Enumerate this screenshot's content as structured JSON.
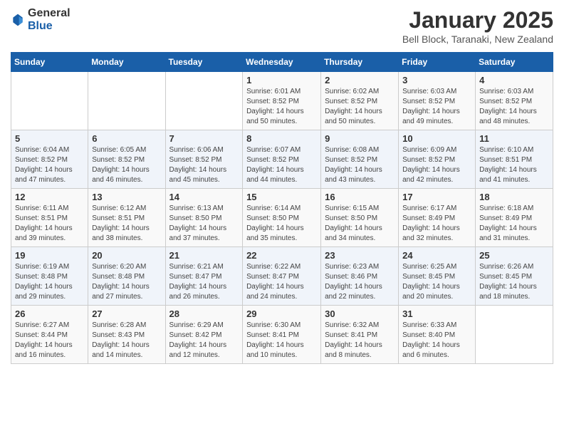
{
  "header": {
    "logo_general": "General",
    "logo_blue": "Blue",
    "month_title": "January 2025",
    "location": "Bell Block, Taranaki, New Zealand"
  },
  "days": [
    "Sunday",
    "Monday",
    "Tuesday",
    "Wednesday",
    "Thursday",
    "Friday",
    "Saturday"
  ],
  "weeks": [
    [
      {
        "date": "",
        "info": ""
      },
      {
        "date": "",
        "info": ""
      },
      {
        "date": "",
        "info": ""
      },
      {
        "date": "1",
        "info": "Sunrise: 6:01 AM\nSunset: 8:52 PM\nDaylight: 14 hours\nand 50 minutes."
      },
      {
        "date": "2",
        "info": "Sunrise: 6:02 AM\nSunset: 8:52 PM\nDaylight: 14 hours\nand 50 minutes."
      },
      {
        "date": "3",
        "info": "Sunrise: 6:03 AM\nSunset: 8:52 PM\nDaylight: 14 hours\nand 49 minutes."
      },
      {
        "date": "4",
        "info": "Sunrise: 6:03 AM\nSunset: 8:52 PM\nDaylight: 14 hours\nand 48 minutes."
      }
    ],
    [
      {
        "date": "5",
        "info": "Sunrise: 6:04 AM\nSunset: 8:52 PM\nDaylight: 14 hours\nand 47 minutes."
      },
      {
        "date": "6",
        "info": "Sunrise: 6:05 AM\nSunset: 8:52 PM\nDaylight: 14 hours\nand 46 minutes."
      },
      {
        "date": "7",
        "info": "Sunrise: 6:06 AM\nSunset: 8:52 PM\nDaylight: 14 hours\nand 45 minutes."
      },
      {
        "date": "8",
        "info": "Sunrise: 6:07 AM\nSunset: 8:52 PM\nDaylight: 14 hours\nand 44 minutes."
      },
      {
        "date": "9",
        "info": "Sunrise: 6:08 AM\nSunset: 8:52 PM\nDaylight: 14 hours\nand 43 minutes."
      },
      {
        "date": "10",
        "info": "Sunrise: 6:09 AM\nSunset: 8:52 PM\nDaylight: 14 hours\nand 42 minutes."
      },
      {
        "date": "11",
        "info": "Sunrise: 6:10 AM\nSunset: 8:51 PM\nDaylight: 14 hours\nand 41 minutes."
      }
    ],
    [
      {
        "date": "12",
        "info": "Sunrise: 6:11 AM\nSunset: 8:51 PM\nDaylight: 14 hours\nand 39 minutes."
      },
      {
        "date": "13",
        "info": "Sunrise: 6:12 AM\nSunset: 8:51 PM\nDaylight: 14 hours\nand 38 minutes."
      },
      {
        "date": "14",
        "info": "Sunrise: 6:13 AM\nSunset: 8:50 PM\nDaylight: 14 hours\nand 37 minutes."
      },
      {
        "date": "15",
        "info": "Sunrise: 6:14 AM\nSunset: 8:50 PM\nDaylight: 14 hours\nand 35 minutes."
      },
      {
        "date": "16",
        "info": "Sunrise: 6:15 AM\nSunset: 8:50 PM\nDaylight: 14 hours\nand 34 minutes."
      },
      {
        "date": "17",
        "info": "Sunrise: 6:17 AM\nSunset: 8:49 PM\nDaylight: 14 hours\nand 32 minutes."
      },
      {
        "date": "18",
        "info": "Sunrise: 6:18 AM\nSunset: 8:49 PM\nDaylight: 14 hours\nand 31 minutes."
      }
    ],
    [
      {
        "date": "19",
        "info": "Sunrise: 6:19 AM\nSunset: 8:48 PM\nDaylight: 14 hours\nand 29 minutes."
      },
      {
        "date": "20",
        "info": "Sunrise: 6:20 AM\nSunset: 8:48 PM\nDaylight: 14 hours\nand 27 minutes."
      },
      {
        "date": "21",
        "info": "Sunrise: 6:21 AM\nSunset: 8:47 PM\nDaylight: 14 hours\nand 26 minutes."
      },
      {
        "date": "22",
        "info": "Sunrise: 6:22 AM\nSunset: 8:47 PM\nDaylight: 14 hours\nand 24 minutes."
      },
      {
        "date": "23",
        "info": "Sunrise: 6:23 AM\nSunset: 8:46 PM\nDaylight: 14 hours\nand 22 minutes."
      },
      {
        "date": "24",
        "info": "Sunrise: 6:25 AM\nSunset: 8:45 PM\nDaylight: 14 hours\nand 20 minutes."
      },
      {
        "date": "25",
        "info": "Sunrise: 6:26 AM\nSunset: 8:45 PM\nDaylight: 14 hours\nand 18 minutes."
      }
    ],
    [
      {
        "date": "26",
        "info": "Sunrise: 6:27 AM\nSunset: 8:44 PM\nDaylight: 14 hours\nand 16 minutes."
      },
      {
        "date": "27",
        "info": "Sunrise: 6:28 AM\nSunset: 8:43 PM\nDaylight: 14 hours\nand 14 minutes."
      },
      {
        "date": "28",
        "info": "Sunrise: 6:29 AM\nSunset: 8:42 PM\nDaylight: 14 hours\nand 12 minutes."
      },
      {
        "date": "29",
        "info": "Sunrise: 6:30 AM\nSunset: 8:41 PM\nDaylight: 14 hours\nand 10 minutes."
      },
      {
        "date": "30",
        "info": "Sunrise: 6:32 AM\nSunset: 8:41 PM\nDaylight: 14 hours\nand 8 minutes."
      },
      {
        "date": "31",
        "info": "Sunrise: 6:33 AM\nSunset: 8:40 PM\nDaylight: 14 hours\nand 6 minutes."
      },
      {
        "date": "",
        "info": ""
      }
    ]
  ]
}
